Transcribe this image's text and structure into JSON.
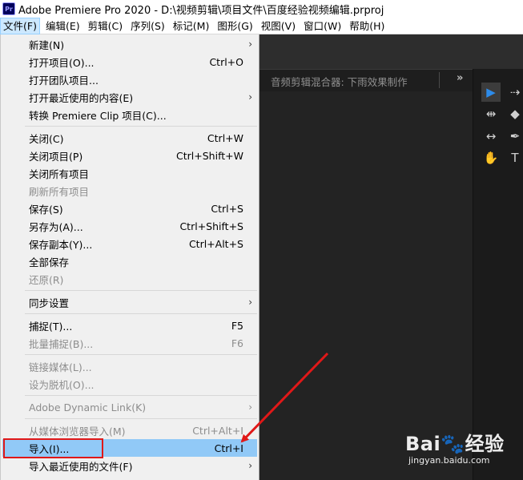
{
  "window": {
    "app_icon": "Pr",
    "title": "Adobe Premiere Pro 2020 - D:\\视频剪辑\\项目文件\\百度经验视频编辑.prproj"
  },
  "menubar": {
    "items": [
      "文件(F)",
      "编辑(E)",
      "剪辑(C)",
      "序列(S)",
      "标记(M)",
      "图形(G)",
      "视图(V)",
      "窗口(W)",
      "帮助(H)"
    ]
  },
  "file_menu": {
    "items": [
      {
        "label": "新建(N)",
        "shortcut": "",
        "submenu": true,
        "enabled": true
      },
      {
        "label": "打开项目(O)...",
        "shortcut": "Ctrl+O",
        "submenu": false,
        "enabled": true
      },
      {
        "label": "打开团队项目...",
        "shortcut": "",
        "submenu": false,
        "enabled": true
      },
      {
        "label": "打开最近使用的内容(E)",
        "shortcut": "",
        "submenu": true,
        "enabled": true
      },
      {
        "label": "转换 Premiere Clip 项目(C)...",
        "shortcut": "",
        "submenu": false,
        "enabled": true
      },
      {
        "label": "关闭(C)",
        "shortcut": "Ctrl+W",
        "submenu": false,
        "enabled": true
      },
      {
        "label": "关闭项目(P)",
        "shortcut": "Ctrl+Shift+W",
        "submenu": false,
        "enabled": true
      },
      {
        "label": "关闭所有项目",
        "shortcut": "",
        "submenu": false,
        "enabled": true
      },
      {
        "label": "刷新所有项目",
        "shortcut": "",
        "submenu": false,
        "enabled": false
      },
      {
        "label": "保存(S)",
        "shortcut": "Ctrl+S",
        "submenu": false,
        "enabled": true
      },
      {
        "label": "另存为(A)...",
        "shortcut": "Ctrl+Shift+S",
        "submenu": false,
        "enabled": true
      },
      {
        "label": "保存副本(Y)...",
        "shortcut": "Ctrl+Alt+S",
        "submenu": false,
        "enabled": true
      },
      {
        "label": "全部保存",
        "shortcut": "",
        "submenu": false,
        "enabled": true
      },
      {
        "label": "还原(R)",
        "shortcut": "",
        "submenu": false,
        "enabled": false
      },
      {
        "label": "同步设置",
        "shortcut": "",
        "submenu": true,
        "enabled": true
      },
      {
        "label": "捕捉(T)...",
        "shortcut": "F5",
        "submenu": false,
        "enabled": true
      },
      {
        "label": "批量捕捉(B)...",
        "shortcut": "F6",
        "submenu": false,
        "enabled": false
      },
      {
        "label": "链接媒体(L)...",
        "shortcut": "",
        "submenu": false,
        "enabled": false
      },
      {
        "label": "设为脱机(O)...",
        "shortcut": "",
        "submenu": false,
        "enabled": false
      },
      {
        "label": "Adobe Dynamic Link(K)",
        "shortcut": "",
        "submenu": true,
        "enabled": false
      },
      {
        "label": "从媒体浏览器导入(M)",
        "shortcut": "Ctrl+Alt+I",
        "submenu": false,
        "enabled": false
      },
      {
        "label": "导入(I)...",
        "shortcut": "Ctrl+I",
        "submenu": false,
        "enabled": true,
        "highlighted": true
      },
      {
        "label": "导入最近使用的文件(F)",
        "shortcut": "",
        "submenu": true,
        "enabled": true
      }
    ]
  },
  "audio_panel": {
    "title": "音频剪辑混合器: 下雨效果制作",
    "overflow_glyph": "»"
  },
  "tools_panel": {
    "tools": [
      {
        "icon": "selection-tool-icon",
        "glyph": "▶",
        "selected": true
      },
      {
        "icon": "track-select-tool-icon",
        "glyph": "⇢",
        "selected": false
      },
      {
        "icon": "ripple-edit-tool-icon",
        "glyph": "⇹",
        "selected": false
      },
      {
        "icon": "razor-tool-icon",
        "glyph": "◆",
        "selected": false
      },
      {
        "icon": "slip-tool-icon",
        "glyph": "↔",
        "selected": false
      },
      {
        "icon": "pen-tool-icon",
        "glyph": "✒",
        "selected": false
      },
      {
        "icon": "hand-tool-icon",
        "glyph": "✋",
        "selected": false
      },
      {
        "icon": "type-tool-icon",
        "glyph": "T",
        "selected": false
      }
    ]
  },
  "annotation": {
    "color": "#e01818"
  },
  "watermark": {
    "brand_prefix": "Bai",
    "paw": "🐾",
    "brand_suffix": "经验",
    "url": "jingyan.baidu.com"
  },
  "colors": {
    "menu_bg": "#f0f0f0",
    "highlight": "#91c9f7",
    "disabled_text": "#8d8d8d",
    "workspace_bg": "#232323"
  }
}
